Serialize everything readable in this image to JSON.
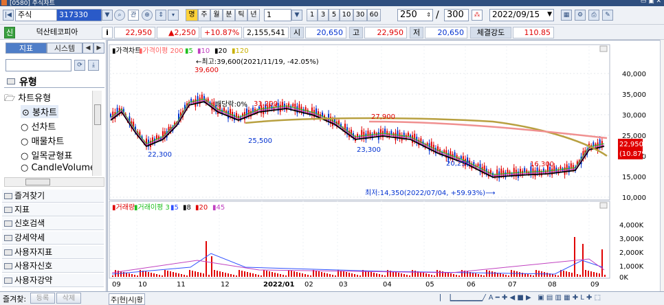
{
  "window": {
    "title": "[0580] 주식차트"
  },
  "toolbar": {
    "asset_type": "주식",
    "code": "317330",
    "tool_search": "⌕",
    "tool_gwan": "관",
    "tool_lock": "⊕",
    "period_myeong": "명",
    "periods": [
      "주",
      "월",
      "분",
      "틱",
      "년"
    ],
    "period_value": "1",
    "minute_options": [
      "1",
      "3",
      "5",
      "10",
      "30",
      "60"
    ],
    "count_value": "250",
    "total_value": "300",
    "date_value": "2022/09/15",
    "slash": "/"
  },
  "quote": {
    "badge": "신",
    "name": "덕산테코피아",
    "info_icon": "i",
    "price": "22,950",
    "change": "▲2,250",
    "change_pct": "+10.87%",
    "volume": "2,155,541",
    "open_label": "시",
    "open": "20,650",
    "high_label": "고",
    "high": "22,950",
    "low_label": "저",
    "low": "20,650",
    "strength_label": "체결강도",
    "strength": "110.85"
  },
  "left_panel": {
    "tabs": [
      "지표",
      "시스템"
    ],
    "section_title": "유형",
    "tree_root": "차트유형",
    "chart_types": [
      "봉차트",
      "선차트",
      "매물차트",
      "일목균형표",
      "CandleVolume"
    ],
    "groups": [
      "즐겨찾기",
      "지표",
      "신호검색",
      "강세약세",
      "사용자지표",
      "사용자신호",
      "사용자강약"
    ]
  },
  "bottom": {
    "fav_label": "즐겨찾:",
    "register": "등록",
    "delete": "삭제",
    "period_tabs": "주|현|시|황"
  },
  "price_panel": {
    "legend": [
      {
        "text": "▮가격차트",
        "color": "#000000"
      },
      {
        "text": "▮가격이평 200",
        "color": "#ff6060"
      },
      {
        "text": "▮5",
        "color": "#20c020"
      },
      {
        "text": "▮10",
        "color": "#c040c0"
      },
      {
        "text": "▮20",
        "color": "#000000"
      },
      {
        "text": "▮120",
        "color": "#c8b000"
      }
    ],
    "annotations": {
      "max": "←최고:39,600(2021/11/19, -42.05%)",
      "max_value": "39,600",
      "dividend": "배당락:0%",
      "v31200": "31,200",
      "v27900": "27,900",
      "v25500": "25,500",
      "v22300": "22,300",
      "v23300": "23,300",
      "v20250": "20,250",
      "v16300": "16,300",
      "min": "최저:14,350(2022/07/04, +59.93%)⟶",
      "current_price": "22,950",
      "current_pct": "(10.87%)"
    },
    "y_ticks": [
      "40,000",
      "35,000",
      "30,000",
      "25,000",
      "20,000",
      "15,000",
      "10,000"
    ]
  },
  "volume_panel": {
    "legend": [
      {
        "text": "▮거래량",
        "color": "#e00000"
      },
      {
        "text": "▮거래이평 3",
        "color": "#20c020"
      },
      {
        "text": "▮5",
        "color": "#3050ff"
      },
      {
        "text": "▮8",
        "color": "#000000"
      },
      {
        "text": "▮20",
        "color": "#e00000"
      },
      {
        "text": "▮45",
        "color": "#c040c0"
      }
    ],
    "y_ticks": [
      "4,000K",
      "3,000K",
      "2,000K",
      "1,000K",
      "0K"
    ]
  },
  "x_axis": [
    "09",
    "10",
    "11",
    "12",
    "2022/01",
    "02",
    "03",
    "04",
    "05",
    "06",
    "07",
    "08",
    "09"
  ]
}
